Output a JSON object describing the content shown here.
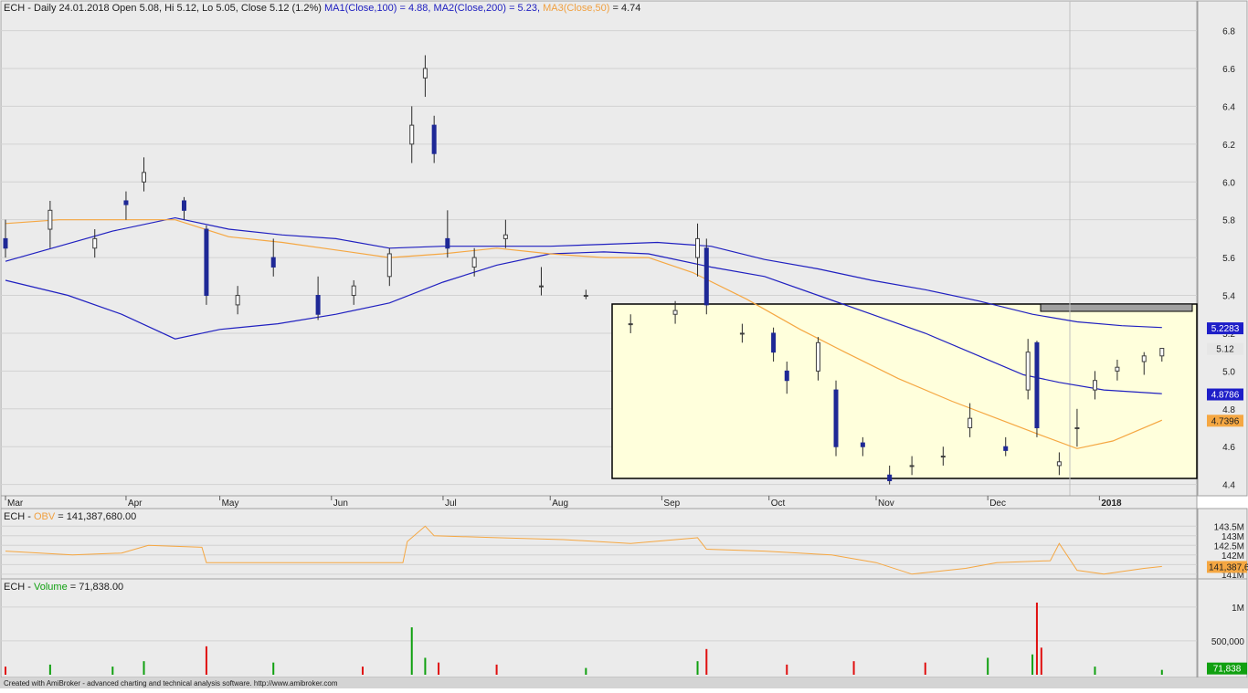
{
  "main_pane": {
    "title_parts": [
      {
        "text": "ECH - Daily 24.01.2018 Open 5.08, Hi 5.12, Lo 5.05, Close 5.12 (1.2%) ",
        "color": "#202020"
      },
      {
        "text": "MA1(Close,100) = 4.88, ",
        "color": "#2020c0"
      },
      {
        "text": "MA2(Close,200) = 5.23, ",
        "color": "#2020c0"
      },
      {
        "text": "MA3(Close,50)",
        "color": "#f0a040"
      },
      {
        "text": " = 4.74",
        "color": "#202020"
      }
    ],
    "price_labels": [
      {
        "text": "5.2283",
        "value": 5.2283,
        "bg": "#1e1ec8",
        "fg": "#ffffff"
      },
      {
        "text": "5.12",
        "value": 5.12,
        "bg": "#e6e6e6",
        "fg": "#202020"
      },
      {
        "text": "4.8786",
        "value": 4.8786,
        "bg": "#1e1ec8",
        "fg": "#ffffff"
      },
      {
        "text": "4.7396",
        "value": 4.7396,
        "bg": "#f5a742",
        "fg": "#202020"
      }
    ]
  },
  "obv_pane": {
    "title_parts": [
      {
        "text": "ECH - ",
        "color": "#202020"
      },
      {
        "text": "OBV",
        "color": "#f0a040"
      },
      {
        "text": " = 141,387,680.00",
        "color": "#202020"
      }
    ],
    "value_label": {
      "text": "141,387,6",
      "bg": "#f5a742",
      "fg": "#202020"
    }
  },
  "volume_pane": {
    "title_parts": [
      {
        "text": "ECH - ",
        "color": "#202020"
      },
      {
        "text": "Volume",
        "color": "#10a010"
      },
      {
        "text": " = 71,838.00",
        "color": "#202020"
      }
    ],
    "value_label": {
      "text": "71,838",
      "bg": "#10a010",
      "fg": "#ffffff"
    }
  },
  "footer": {
    "text": "Created with AmiBroker - advanced charting and technical analysis software. http://www.amibroker.com"
  },
  "colors": {
    "up_candle": "#ffffff",
    "down_candle": "#1e2896",
    "ma_blue": "#2020c0",
    "ma_orange": "#f5a742",
    "box_fill": "#ffffdc",
    "pane_bg": "#ebebeb",
    "vol_up": "#10a010",
    "vol_down": "#e01010"
  },
  "chart_data": [
    {
      "type": "candlestick",
      "title": "ECH - Daily 24.01.2018",
      "y_ticks": [
        "4.4",
        "4.6",
        "4.8",
        "5.0",
        "5.2",
        "5.4",
        "5.6",
        "5.8",
        "6.0",
        "6.2",
        "6.4",
        "6.6",
        "6.8"
      ],
      "ylim": [
        4.35,
        6.88
      ],
      "x_ticks": [
        "Mar",
        "Apr",
        "May",
        "Jun",
        "Jul",
        "Aug",
        "Sep",
        "Oct",
        "Nov",
        "Dec",
        "2018"
      ],
      "x_tick_positions": [
        0,
        27,
        48,
        73,
        98,
        122,
        147,
        171,
        195,
        220,
        245
      ],
      "x_count": 266,
      "candles": [
        [
          0,
          5.7,
          5.8,
          5.6,
          5.65
        ],
        [
          10,
          5.75,
          5.9,
          5.65,
          5.85
        ],
        [
          20,
          5.65,
          5.75,
          5.6,
          5.7
        ],
        [
          27,
          5.9,
          5.95,
          5.8,
          5.88
        ],
        [
          31,
          6.0,
          6.13,
          5.95,
          6.05
        ],
        [
          40,
          5.9,
          5.92,
          5.8,
          5.85
        ],
        [
          45,
          5.75,
          5.77,
          5.35,
          5.4
        ],
        [
          52,
          5.35,
          5.45,
          5.3,
          5.4
        ],
        [
          60,
          5.6,
          5.7,
          5.5,
          5.55
        ],
        [
          70,
          5.4,
          5.5,
          5.27,
          5.3
        ],
        [
          78,
          5.4,
          5.48,
          5.35,
          5.45
        ],
        [
          86,
          5.5,
          5.65,
          5.45,
          5.62
        ],
        [
          91,
          6.2,
          6.4,
          6.1,
          6.3
        ],
        [
          94,
          6.55,
          6.67,
          6.45,
          6.6
        ],
        [
          96,
          6.3,
          6.35,
          6.1,
          6.15
        ],
        [
          99,
          5.7,
          5.85,
          5.6,
          5.65
        ],
        [
          105,
          5.55,
          5.65,
          5.5,
          5.6
        ],
        [
          112,
          5.7,
          5.8,
          5.65,
          5.72
        ],
        [
          120,
          5.45,
          5.55,
          5.4,
          5.45
        ],
        [
          130,
          5.4,
          5.43,
          5.38,
          5.4
        ],
        [
          140,
          5.25,
          5.3,
          5.2,
          5.25
        ],
        [
          150,
          5.3,
          5.37,
          5.25,
          5.32
        ],
        [
          155,
          5.6,
          5.78,
          5.5,
          5.7
        ],
        [
          157,
          5.65,
          5.7,
          5.3,
          5.35
        ],
        [
          165,
          5.2,
          5.25,
          5.15,
          5.2
        ],
        [
          172,
          5.2,
          5.23,
          5.05,
          5.1
        ],
        [
          175,
          5.0,
          5.05,
          4.88,
          4.95
        ],
        [
          182,
          5.0,
          5.18,
          4.95,
          5.15
        ],
        [
          186,
          4.9,
          4.95,
          4.55,
          4.6
        ],
        [
          192,
          4.62,
          4.65,
          4.55,
          4.6
        ],
        [
          198,
          4.45,
          4.5,
          4.4,
          4.42
        ],
        [
          203,
          4.5,
          4.55,
          4.45,
          4.5
        ],
        [
          210,
          4.55,
          4.6,
          4.5,
          4.55
        ],
        [
          216,
          4.7,
          4.83,
          4.65,
          4.75
        ],
        [
          224,
          4.6,
          4.65,
          4.55,
          4.58
        ],
        [
          229,
          4.9,
          5.17,
          4.85,
          5.1
        ],
        [
          231,
          5.15,
          5.16,
          4.65,
          4.7
        ],
        [
          236,
          4.5,
          4.57,
          4.45,
          4.52
        ],
        [
          240,
          4.7,
          4.8,
          4.6,
          4.7
        ],
        [
          244,
          4.9,
          5.0,
          4.85,
          4.95
        ],
        [
          249,
          5.0,
          5.06,
          4.95,
          5.02
        ],
        [
          255,
          5.05,
          5.1,
          4.98,
          5.08
        ],
        [
          259,
          5.08,
          5.12,
          5.05,
          5.12
        ]
      ],
      "ma_100": [
        [
          0,
          5.48
        ],
        [
          14,
          5.4
        ],
        [
          26,
          5.3
        ],
        [
          38,
          5.17
        ],
        [
          48,
          5.22
        ],
        [
          61,
          5.25
        ],
        [
          74,
          5.3
        ],
        [
          86,
          5.36
        ],
        [
          98,
          5.47
        ],
        [
          110,
          5.56
        ],
        [
          122,
          5.62
        ],
        [
          134,
          5.63
        ],
        [
          144,
          5.62
        ],
        [
          158,
          5.55
        ],
        [
          170,
          5.5
        ],
        [
          182,
          5.4
        ],
        [
          194,
          5.3
        ],
        [
          206,
          5.2
        ],
        [
          218,
          5.08
        ],
        [
          228,
          4.98
        ],
        [
          236,
          4.94
        ],
        [
          246,
          4.9
        ],
        [
          259,
          4.88
        ]
      ],
      "ma_200": [
        [
          0,
          5.58
        ],
        [
          12,
          5.66
        ],
        [
          24,
          5.74
        ],
        [
          38,
          5.81
        ],
        [
          50,
          5.75
        ],
        [
          62,
          5.72
        ],
        [
          74,
          5.7
        ],
        [
          86,
          5.65
        ],
        [
          98,
          5.66
        ],
        [
          110,
          5.66
        ],
        [
          122,
          5.66
        ],
        [
          134,
          5.67
        ],
        [
          146,
          5.68
        ],
        [
          158,
          5.66
        ],
        [
          170,
          5.59
        ],
        [
          182,
          5.54
        ],
        [
          194,
          5.48
        ],
        [
          206,
          5.43
        ],
        [
          218,
          5.37
        ],
        [
          230,
          5.3
        ],
        [
          240,
          5.26
        ],
        [
          250,
          5.24
        ],
        [
          259,
          5.23
        ]
      ],
      "ma_50": [
        [
          0,
          5.78
        ],
        [
          12,
          5.8
        ],
        [
          24,
          5.8
        ],
        [
          38,
          5.8
        ],
        [
          50,
          5.71
        ],
        [
          62,
          5.68
        ],
        [
          74,
          5.64
        ],
        [
          86,
          5.6
        ],
        [
          98,
          5.62
        ],
        [
          110,
          5.65
        ],
        [
          122,
          5.62
        ],
        [
          134,
          5.6
        ],
        [
          144,
          5.6
        ],
        [
          154,
          5.52
        ],
        [
          166,
          5.38
        ],
        [
          178,
          5.22
        ],
        [
          188,
          5.1
        ],
        [
          200,
          4.96
        ],
        [
          212,
          4.84
        ],
        [
          222,
          4.75
        ],
        [
          232,
          4.66
        ],
        [
          240,
          4.59
        ],
        [
          248,
          4.63
        ],
        [
          259,
          4.74
        ]
      ]
    },
    {
      "type": "line",
      "title": "OBV",
      "y_ticks": [
        "141M",
        "141.5M",
        "142M",
        "142.5M",
        "143M",
        "143.5M"
      ],
      "ylim": [
        140.85,
        143.75
      ],
      "x_count": 266,
      "values": [
        [
          0,
          142.2
        ],
        [
          15,
          142.0
        ],
        [
          26,
          142.1
        ],
        [
          32,
          142.5
        ],
        [
          44,
          142.4
        ],
        [
          45,
          141.6
        ],
        [
          70,
          141.6
        ],
        [
          89,
          141.6
        ],
        [
          90,
          142.7
        ],
        [
          94,
          143.5
        ],
        [
          96,
          143.0
        ],
        [
          110,
          142.9
        ],
        [
          125,
          142.8
        ],
        [
          140,
          142.6
        ],
        [
          155,
          142.9
        ],
        [
          157,
          142.3
        ],
        [
          170,
          142.2
        ],
        [
          185,
          142.0
        ],
        [
          195,
          141.6
        ],
        [
          203,
          141.0
        ],
        [
          215,
          141.3
        ],
        [
          222,
          141.6
        ],
        [
          234,
          141.7
        ],
        [
          236,
          142.6
        ],
        [
          240,
          141.2
        ],
        [
          246,
          141.0
        ],
        [
          255,
          141.3
        ],
        [
          259,
          141.4
        ]
      ]
    },
    {
      "type": "bar",
      "title": "Volume",
      "y_ticks": [
        "500,000",
        "1M"
      ],
      "ylim": [
        0,
        1200000
      ],
      "x_count": 266,
      "values": [
        [
          0,
          120000,
          "d"
        ],
        [
          10,
          150000,
          "u"
        ],
        [
          24,
          120000,
          "u"
        ],
        [
          31,
          200000,
          "u"
        ],
        [
          45,
          420000,
          "d"
        ],
        [
          60,
          180000,
          "u"
        ],
        [
          80,
          120000,
          "d"
        ],
        [
          91,
          700000,
          "u"
        ],
        [
          94,
          250000,
          "u"
        ],
        [
          97,
          180000,
          "d"
        ],
        [
          110,
          150000,
          "d"
        ],
        [
          130,
          100000,
          "u"
        ],
        [
          155,
          200000,
          "u"
        ],
        [
          157,
          380000,
          "d"
        ],
        [
          175,
          150000,
          "d"
        ],
        [
          190,
          200000,
          "d"
        ],
        [
          206,
          180000,
          "d"
        ],
        [
          220,
          250000,
          "u"
        ],
        [
          230,
          300000,
          "u"
        ],
        [
          231,
          1100000,
          "d"
        ],
        [
          232,
          400000,
          "d"
        ],
        [
          244,
          120000,
          "u"
        ],
        [
          259,
          71838,
          "u"
        ]
      ]
    }
  ]
}
